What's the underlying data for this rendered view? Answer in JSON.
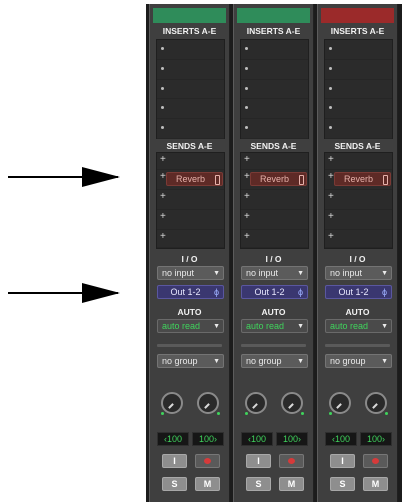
{
  "callouts": [
    "sends-arrow",
    "output-arrow"
  ],
  "strips": [
    {
      "color": "#2f8c5a",
      "inserts_label": "INSERTS A-E",
      "sends_label": "SENDS A-E",
      "send_a": "Reverb",
      "io_label": "I / O",
      "input": "no input",
      "output": "Out 1-2",
      "auto_label": "AUTO",
      "auto_mode": "auto read",
      "group": "no group",
      "pan_left": "‹100",
      "pan_right": "100›",
      "input_monitor": "I",
      "solo": "S",
      "mute": "M"
    },
    {
      "color": "#2f8c5a",
      "inserts_label": "INSERTS A-E",
      "sends_label": "SENDS A-E",
      "send_a": "Reverb",
      "io_label": "I / O",
      "input": "no input",
      "output": "Out 1-2",
      "auto_label": "AUTO",
      "auto_mode": "auto read",
      "group": "no group",
      "pan_left": "‹100",
      "pan_right": "100›",
      "input_monitor": "I",
      "solo": "S",
      "mute": "M"
    },
    {
      "color": "#9b2a2a",
      "inserts_label": "INSERTS A-E",
      "sends_label": "SENDS A-E",
      "send_a": "Reverb",
      "io_label": "I / O",
      "input": "no input",
      "output": "Out 1-2",
      "auto_label": "AUTO",
      "auto_mode": "auto read",
      "group": "no group",
      "pan_left": "‹100",
      "pan_right": "100›",
      "input_monitor": "I",
      "solo": "S",
      "mute": "M"
    }
  ]
}
